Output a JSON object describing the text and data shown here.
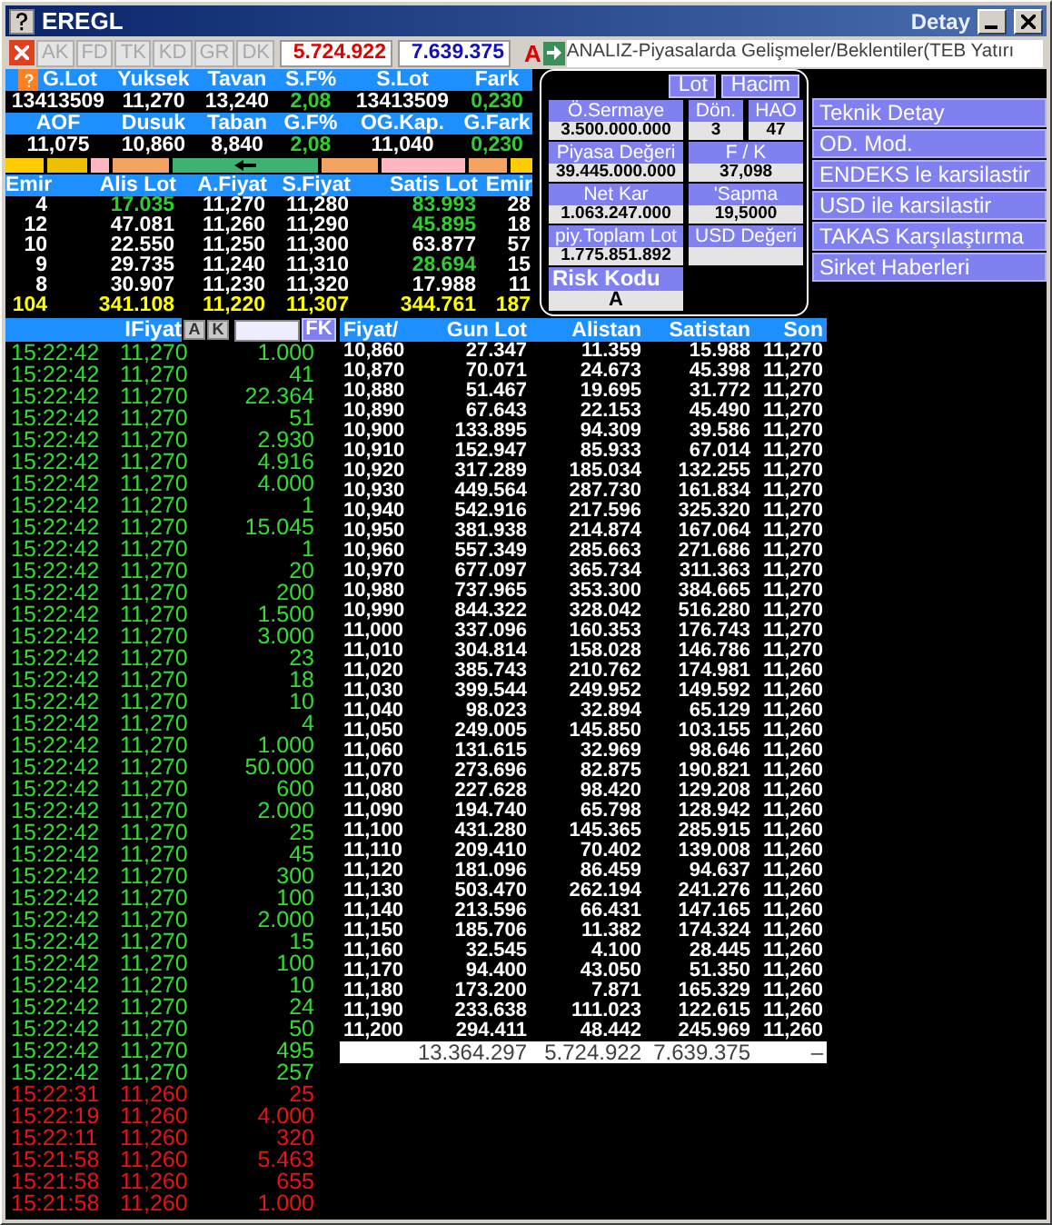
{
  "window": {
    "title": "EREGL",
    "caption_right": "Detay"
  },
  "toolbar": {
    "tabs": [
      {
        "label": "AK",
        "disabled": true
      },
      {
        "label": "FD",
        "disabled": true
      },
      {
        "label": "TK",
        "disabled": true
      },
      {
        "label": "KD",
        "disabled": true
      },
      {
        "label": "GR",
        "disabled": true
      },
      {
        "label": "DK",
        "disabled": true
      }
    ],
    "bid_total": "5.724.922",
    "ask_total": "7.639.375",
    "risk_flag": "A",
    "ticker": "ANALIZ-Piyasalarda Gelişmeler/Beklentiler(TEB Yatırı"
  },
  "stats_rows": [
    [
      {
        "label": "G.Lot",
        "value": "13413509",
        "highlight": false
      },
      {
        "label": "Yuksek",
        "value": "11,270",
        "highlight": false
      },
      {
        "label": "Tavan",
        "value": "13,240",
        "highlight": false
      },
      {
        "label": "S.F%",
        "value": "2,08",
        "highlight": true
      },
      {
        "label": "S.Lot",
        "value": "13413509",
        "highlight": false
      },
      {
        "label": "Fark",
        "value": "0,230",
        "highlight": true
      }
    ],
    [
      {
        "label": "AOF",
        "value": "11,075",
        "highlight": false
      },
      {
        "label": "Dusuk",
        "value": "10,860",
        "highlight": false
      },
      {
        "label": "Taban",
        "value": "8,840",
        "highlight": false
      },
      {
        "label": "G.F%",
        "value": "2,08",
        "highlight": true
      },
      {
        "label": "OG.Kap.",
        "value": "11,040",
        "highlight": false
      },
      {
        "label": "G.Fark",
        "value": "0,230",
        "highlight": true
      }
    ]
  ],
  "color_bar": [
    {
      "color": "#ffcc00",
      "marker": false
    },
    {
      "color": "#f0c000",
      "marker": false
    },
    {
      "color": "#ffb6c1",
      "marker": false
    },
    {
      "color": "#f4a460",
      "marker": false
    },
    {
      "color": "#3cb371",
      "marker": true
    },
    {
      "color": "#f4a460",
      "marker": false
    },
    {
      "color": "#ffb6c1",
      "marker": false
    },
    {
      "color": "#f4a460",
      "marker": false
    },
    {
      "color": "#ffcc00",
      "marker": false
    }
  ],
  "depth": {
    "columns": [
      "Emir",
      "Alis Lot",
      "A.Fiyat",
      "S.Fiyat",
      "Satis Lot",
      "Emir"
    ],
    "rows": [
      {
        "bid_orders": "4",
        "bid_lot": "17.035",
        "bid_lot_changed": true,
        "bid": "11,270",
        "ask": "11,280",
        "ask_lot": "83.993",
        "ask_lot_changed": true,
        "ask_orders": "28"
      },
      {
        "bid_orders": "12",
        "bid_lot": "47.081",
        "bid_lot_changed": false,
        "bid": "11,260",
        "ask": "11,290",
        "ask_lot": "45.895",
        "ask_lot_changed": true,
        "ask_orders": "18"
      },
      {
        "bid_orders": "10",
        "bid_lot": "22.550",
        "bid_lot_changed": false,
        "bid": "11,250",
        "ask": "11,300",
        "ask_lot": "63.877",
        "ask_lot_changed": false,
        "ask_orders": "57"
      },
      {
        "bid_orders": "9",
        "bid_lot": "29.735",
        "bid_lot_changed": false,
        "bid": "11,240",
        "ask": "11,310",
        "ask_lot": "28.694",
        "ask_lot_changed": true,
        "ask_orders": "15"
      },
      {
        "bid_orders": "8",
        "bid_lot": "30.907",
        "bid_lot_changed": false,
        "bid": "11,230",
        "ask": "11,320",
        "ask_lot": "17.988",
        "ask_lot_changed": false,
        "ask_orders": "11"
      }
    ],
    "totals": [
      "104",
      "341.108",
      "11,220",
      "11,307",
      "344.761",
      "187"
    ]
  },
  "detail": {
    "buttons": [
      "Lot",
      "Hacim"
    ],
    "rows": [
      [
        {
          "label": "Ö.Sermaye",
          "value": "3.500.000.000"
        },
        {
          "label": "Dön.",
          "value": "3"
        },
        {
          "label": "HAO",
          "value": "47"
        }
      ],
      [
        {
          "label": "Piyasa Değeri",
          "value": "39.445.000.000"
        },
        {
          "label": "F / K",
          "value": "37,098"
        }
      ],
      [
        {
          "label": "Net Kar",
          "value": "1.063.247.000"
        },
        {
          "label": "'Sapma",
          "value": "19,5000"
        }
      ],
      [
        {
          "label": "piy.Toplam Lot",
          "value": "1.775.851.892"
        },
        {
          "label": "USD Değeri"
        }
      ]
    ],
    "risk": {
      "label": "Risk Kodu",
      "value": "A"
    }
  },
  "menu": [
    "Teknik Detay",
    "OD. Mod.",
    "ENDEKS le karsilastir",
    "USD ile karsilastir",
    "TAKAS Karşılaştırma",
    "Sirket Haberleri"
  ],
  "tape": {
    "header": "IFiyat",
    "buttons": [
      "A",
      "K"
    ],
    "filter_button": "FK",
    "trades": [
      {
        "time": "15:22:42",
        "price": "11,270",
        "lot": "1.000",
        "up": true
      },
      {
        "time": "15:22:42",
        "price": "11,270",
        "lot": "41",
        "up": true
      },
      {
        "time": "15:22:42",
        "price": "11,270",
        "lot": "22.364",
        "up": true
      },
      {
        "time": "15:22:42",
        "price": "11,270",
        "lot": "51",
        "up": true
      },
      {
        "time": "15:22:42",
        "price": "11,270",
        "lot": "2.930",
        "up": true
      },
      {
        "time": "15:22:42",
        "price": "11,270",
        "lot": "4.916",
        "up": true
      },
      {
        "time": "15:22:42",
        "price": "11,270",
        "lot": "4.000",
        "up": true
      },
      {
        "time": "15:22:42",
        "price": "11,270",
        "lot": "1",
        "up": true
      },
      {
        "time": "15:22:42",
        "price": "11,270",
        "lot": "15.045",
        "up": true
      },
      {
        "time": "15:22:42",
        "price": "11,270",
        "lot": "1",
        "up": true
      },
      {
        "time": "15:22:42",
        "price": "11,270",
        "lot": "20",
        "up": true
      },
      {
        "time": "15:22:42",
        "price": "11,270",
        "lot": "200",
        "up": true
      },
      {
        "time": "15:22:42",
        "price": "11,270",
        "lot": "1.500",
        "up": true
      },
      {
        "time": "15:22:42",
        "price": "11,270",
        "lot": "3.000",
        "up": true
      },
      {
        "time": "15:22:42",
        "price": "11,270",
        "lot": "23",
        "up": true
      },
      {
        "time": "15:22:42",
        "price": "11,270",
        "lot": "18",
        "up": true
      },
      {
        "time": "15:22:42",
        "price": "11,270",
        "lot": "10",
        "up": true
      },
      {
        "time": "15:22:42",
        "price": "11,270",
        "lot": "4",
        "up": true
      },
      {
        "time": "15:22:42",
        "price": "11,270",
        "lot": "1.000",
        "up": true
      },
      {
        "time": "15:22:42",
        "price": "11,270",
        "lot": "50.000",
        "up": true
      },
      {
        "time": "15:22:42",
        "price": "11,270",
        "lot": "600",
        "up": true
      },
      {
        "time": "15:22:42",
        "price": "11,270",
        "lot": "2.000",
        "up": true
      },
      {
        "time": "15:22:42",
        "price": "11,270",
        "lot": "25",
        "up": true
      },
      {
        "time": "15:22:42",
        "price": "11,270",
        "lot": "45",
        "up": true
      },
      {
        "time": "15:22:42",
        "price": "11,270",
        "lot": "300",
        "up": true
      },
      {
        "time": "15:22:42",
        "price": "11,270",
        "lot": "100",
        "up": true
      },
      {
        "time": "15:22:42",
        "price": "11,270",
        "lot": "2.000",
        "up": true
      },
      {
        "time": "15:22:42",
        "price": "11,270",
        "lot": "15",
        "up": true
      },
      {
        "time": "15:22:42",
        "price": "11,270",
        "lot": "100",
        "up": true
      },
      {
        "time": "15:22:42",
        "price": "11,270",
        "lot": "10",
        "up": true
      },
      {
        "time": "15:22:42",
        "price": "11,270",
        "lot": "24",
        "up": true
      },
      {
        "time": "15:22:42",
        "price": "11,270",
        "lot": "50",
        "up": true
      },
      {
        "time": "15:22:42",
        "price": "11,270",
        "lot": "495",
        "up": true
      },
      {
        "time": "15:22:42",
        "price": "11,270",
        "lot": "257",
        "up": true
      },
      {
        "time": "15:22:31",
        "price": "11,260",
        "lot": "25",
        "up": false
      },
      {
        "time": "15:22:19",
        "price": "11,260",
        "lot": "4.000",
        "up": false
      },
      {
        "time": "15:22:11",
        "price": "11,260",
        "lot": "320",
        "up": false
      },
      {
        "time": "15:21:58",
        "price": "11,260",
        "lot": "5.463",
        "up": false
      },
      {
        "time": "15:21:58",
        "price": "11,260",
        "lot": "655",
        "up": false
      },
      {
        "time": "15:21:58",
        "price": "11,260",
        "lot": "1.000",
        "up": false
      }
    ]
  },
  "price_table": {
    "columns": [
      "Fiyat/",
      "Gun Lot",
      "Alistan",
      "Satistan",
      "Son"
    ],
    "rows": [
      [
        "10,860",
        "27.347",
        "11.359",
        "15.988",
        "11,270"
      ],
      [
        "10,870",
        "70.071",
        "24.673",
        "45.398",
        "11,270"
      ],
      [
        "10,880",
        "51.467",
        "19.695",
        "31.772",
        "11,270"
      ],
      [
        "10,890",
        "67.643",
        "22.153",
        "45.490",
        "11,270"
      ],
      [
        "10,900",
        "133.895",
        "94.309",
        "39.586",
        "11,270"
      ],
      [
        "10,910",
        "152.947",
        "85.933",
        "67.014",
        "11,270"
      ],
      [
        "10,920",
        "317.289",
        "185.034",
        "132.255",
        "11,270"
      ],
      [
        "10,930",
        "449.564",
        "287.730",
        "161.834",
        "11,270"
      ],
      [
        "10,940",
        "542.916",
        "217.596",
        "325.320",
        "11,270"
      ],
      [
        "10,950",
        "381.938",
        "214.874",
        "167.064",
        "11,270"
      ],
      [
        "10,960",
        "557.349",
        "285.663",
        "271.686",
        "11,270"
      ],
      [
        "10,970",
        "677.097",
        "365.734",
        "311.363",
        "11,270"
      ],
      [
        "10,980",
        "737.965",
        "353.300",
        "384.665",
        "11,270"
      ],
      [
        "10,990",
        "844.322",
        "328.042",
        "516.280",
        "11,270"
      ],
      [
        "11,000",
        "337.096",
        "160.353",
        "176.743",
        "11,270"
      ],
      [
        "11,010",
        "304.814",
        "158.028",
        "146.786",
        "11,270"
      ],
      [
        "11,020",
        "385.743",
        "210.762",
        "174.981",
        "11,260"
      ],
      [
        "11,030",
        "399.544",
        "249.952",
        "149.592",
        "11,260"
      ],
      [
        "11,040",
        "98.023",
        "32.894",
        "65.129",
        "11,260"
      ],
      [
        "11,050",
        "249.005",
        "145.850",
        "103.155",
        "11,260"
      ],
      [
        "11,060",
        "131.615",
        "32.969",
        "98.646",
        "11,260"
      ],
      [
        "11,070",
        "273.696",
        "82.875",
        "190.821",
        "11,260"
      ],
      [
        "11,080",
        "227.628",
        "98.420",
        "129.208",
        "11,260"
      ],
      [
        "11,090",
        "194.740",
        "65.798",
        "128.942",
        "11,260"
      ],
      [
        "11,100",
        "431.280",
        "145.365",
        "285.915",
        "11,260"
      ],
      [
        "11,110",
        "209.410",
        "70.402",
        "139.008",
        "11,260"
      ],
      [
        "11,120",
        "181.096",
        "86.459",
        "94.637",
        "11,260"
      ],
      [
        "11,130",
        "503.470",
        "262.194",
        "241.276",
        "11,260"
      ],
      [
        "11,140",
        "213.596",
        "66.431",
        "147.165",
        "11,260"
      ],
      [
        "11,150",
        "185.706",
        "11.382",
        "174.324",
        "11,260"
      ],
      [
        "11,160",
        "32.545",
        "4.100",
        "28.445",
        "11,260"
      ],
      [
        "11,170",
        "94.400",
        "43.050",
        "51.350",
        "11,260"
      ],
      [
        "11,180",
        "173.200",
        "7.871",
        "165.329",
        "11,260"
      ],
      [
        "11,190",
        "233.638",
        "111.023",
        "122.615",
        "11,260"
      ],
      [
        "11,200",
        "294.411",
        "48.442",
        "245.969",
        "11,260"
      ]
    ],
    "totals": [
      "13.364.297",
      "5.724.922",
      "7.639.375",
      "–"
    ]
  }
}
